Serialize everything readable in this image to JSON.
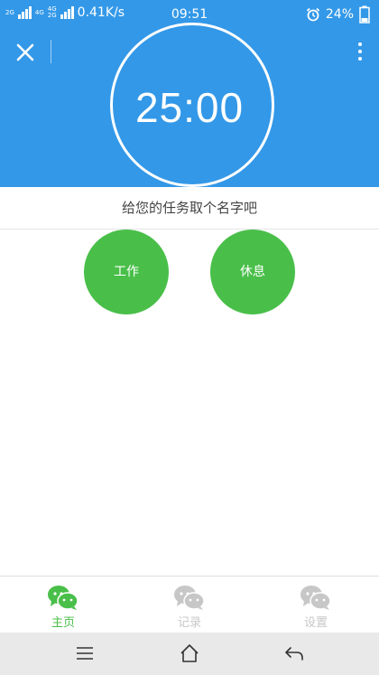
{
  "status_bar": {
    "net_label_1": "2G",
    "net_label_2": "4G",
    "net_label_3": "4G",
    "net_label_4": "2G",
    "speed": "0.41K/s",
    "time": "09:51",
    "battery": "24%"
  },
  "timer": {
    "display": "25:00"
  },
  "task": {
    "prompt": "给您的任务取个名字吧"
  },
  "modes": {
    "work": "工作",
    "rest": "休息"
  },
  "nav": {
    "items": [
      {
        "label": "主页",
        "active": true
      },
      {
        "label": "记录",
        "active": false
      },
      {
        "label": "设置",
        "active": false
      }
    ]
  },
  "colors": {
    "header_blue": "#3398e8",
    "accent_green": "#49bf49",
    "nav_inactive": "#c7c7c7"
  }
}
